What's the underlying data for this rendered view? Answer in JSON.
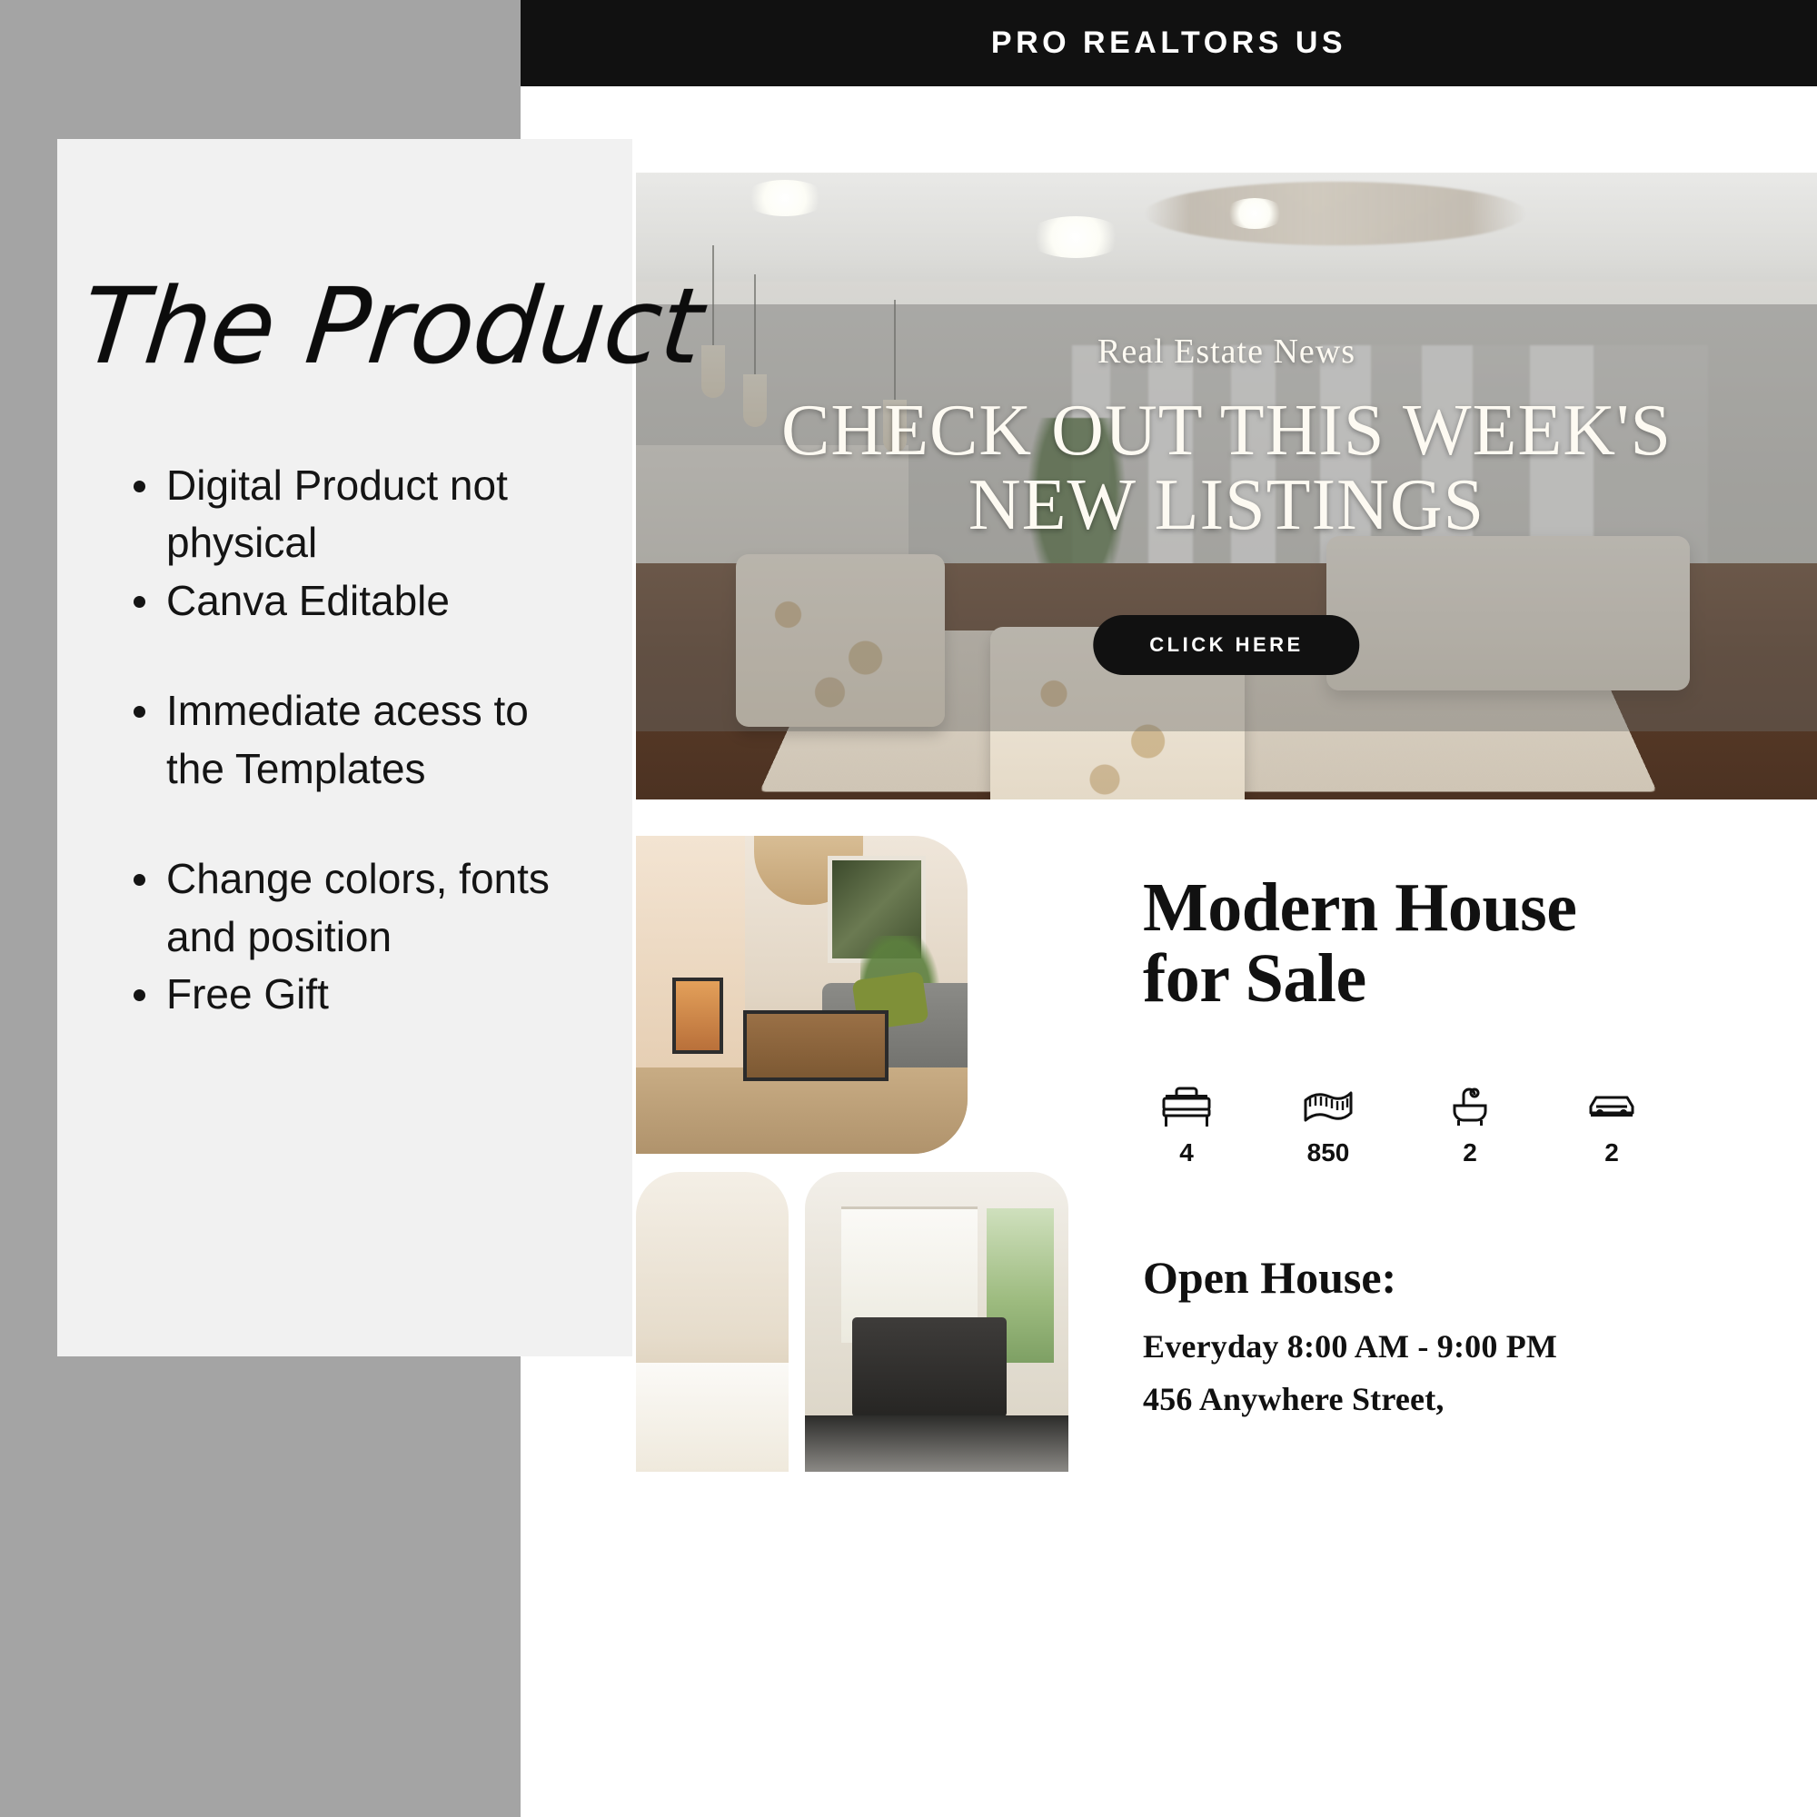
{
  "left_panel": {
    "title": "The Product",
    "bullets": [
      {
        "text": "Digital Product not physical",
        "gap_before": false
      },
      {
        "text": "Canva Editable",
        "gap_before": false
      },
      {
        "text": "Immediate acess to the Templates",
        "gap_before": true
      },
      {
        "text": "Change colors, fonts and position",
        "gap_before": true
      },
      {
        "text": "Free Gift",
        "gap_before": false
      }
    ]
  },
  "mockup": {
    "header_title": "PRO REALTORS US",
    "hero": {
      "kicker": "Real Estate News",
      "title_line1": "CHECK OUT THIS WEEK'S",
      "title_line2": "NEW LISTINGS",
      "cta_label": "CLICK HERE"
    },
    "listing": {
      "title_line1": "Modern House",
      "title_line2": "for Sale",
      "specs": [
        {
          "icon": "bed-icon",
          "value": "4"
        },
        {
          "icon": "measuring-tape-icon",
          "value": "850"
        },
        {
          "icon": "bathtub-icon",
          "value": "2"
        },
        {
          "icon": "car-icon",
          "value": "2"
        }
      ],
      "open_house_label": "Open House:",
      "open_house_hours": "Everyday 8:00 AM - 9:00 PM",
      "open_house_address": "456 Anywhere Street,"
    }
  },
  "colors": {
    "background_gray": "#a4a4a4",
    "panel_gray": "#f1f1f1",
    "header_black": "#111111",
    "text_black": "#141414",
    "hero_text_cream": "#fdfaf2"
  }
}
